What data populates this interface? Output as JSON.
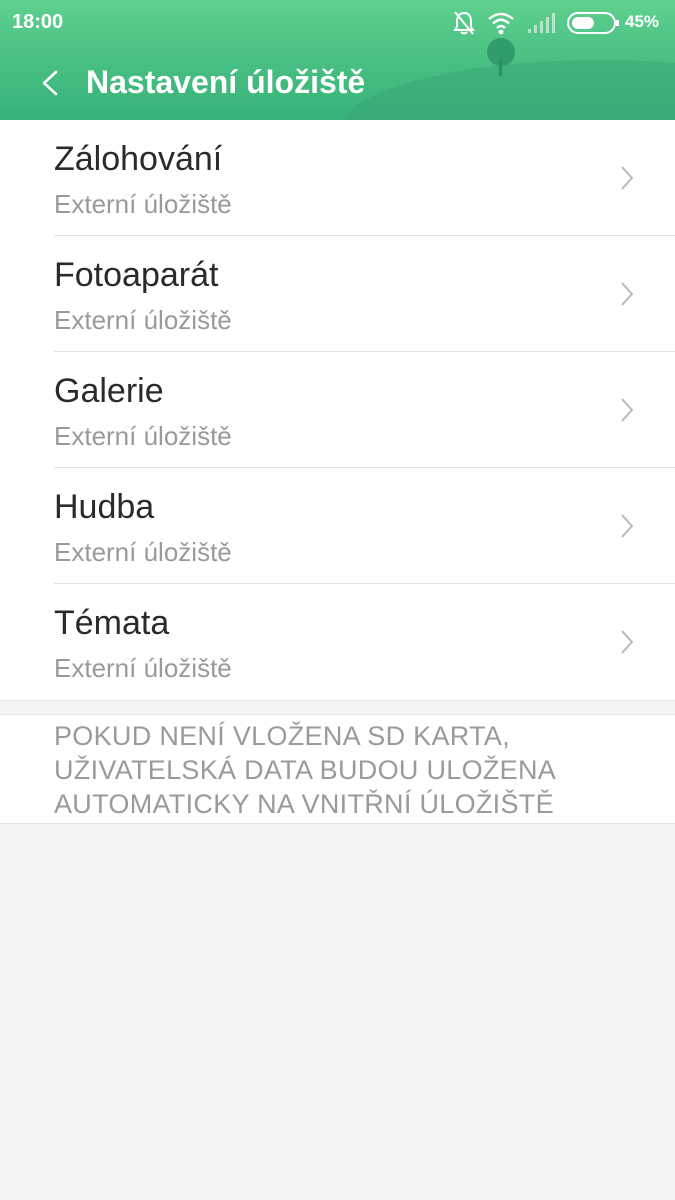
{
  "status_bar": {
    "time": "18:00",
    "battery_percent": "45%",
    "icons": [
      "bell-muted-icon",
      "wifi-icon",
      "signal-icon",
      "battery-icon"
    ]
  },
  "header": {
    "title": "Nastavení úložiště",
    "back_icon": "chevron-left-icon",
    "accent_color": "#45bd80"
  },
  "items": [
    {
      "title": "Zálohování",
      "subtitle": "Externí úložiště"
    },
    {
      "title": "Fotoaparát",
      "subtitle": "Externí úložiště"
    },
    {
      "title": "Galerie",
      "subtitle": "Externí úložiště"
    },
    {
      "title": "Hudba",
      "subtitle": "Externí úložiště"
    },
    {
      "title": "Témata",
      "subtitle": "Externí úložiště"
    }
  ],
  "note": {
    "lines": [
      "POKUD NENÍ VLOŽENA SD KARTA,",
      "UŽIVATELSKÁ DATA BUDOU ULOŽENA",
      "AUTOMATICKY NA VNITŘNÍ ÚLOŽIŠTĚ"
    ]
  }
}
